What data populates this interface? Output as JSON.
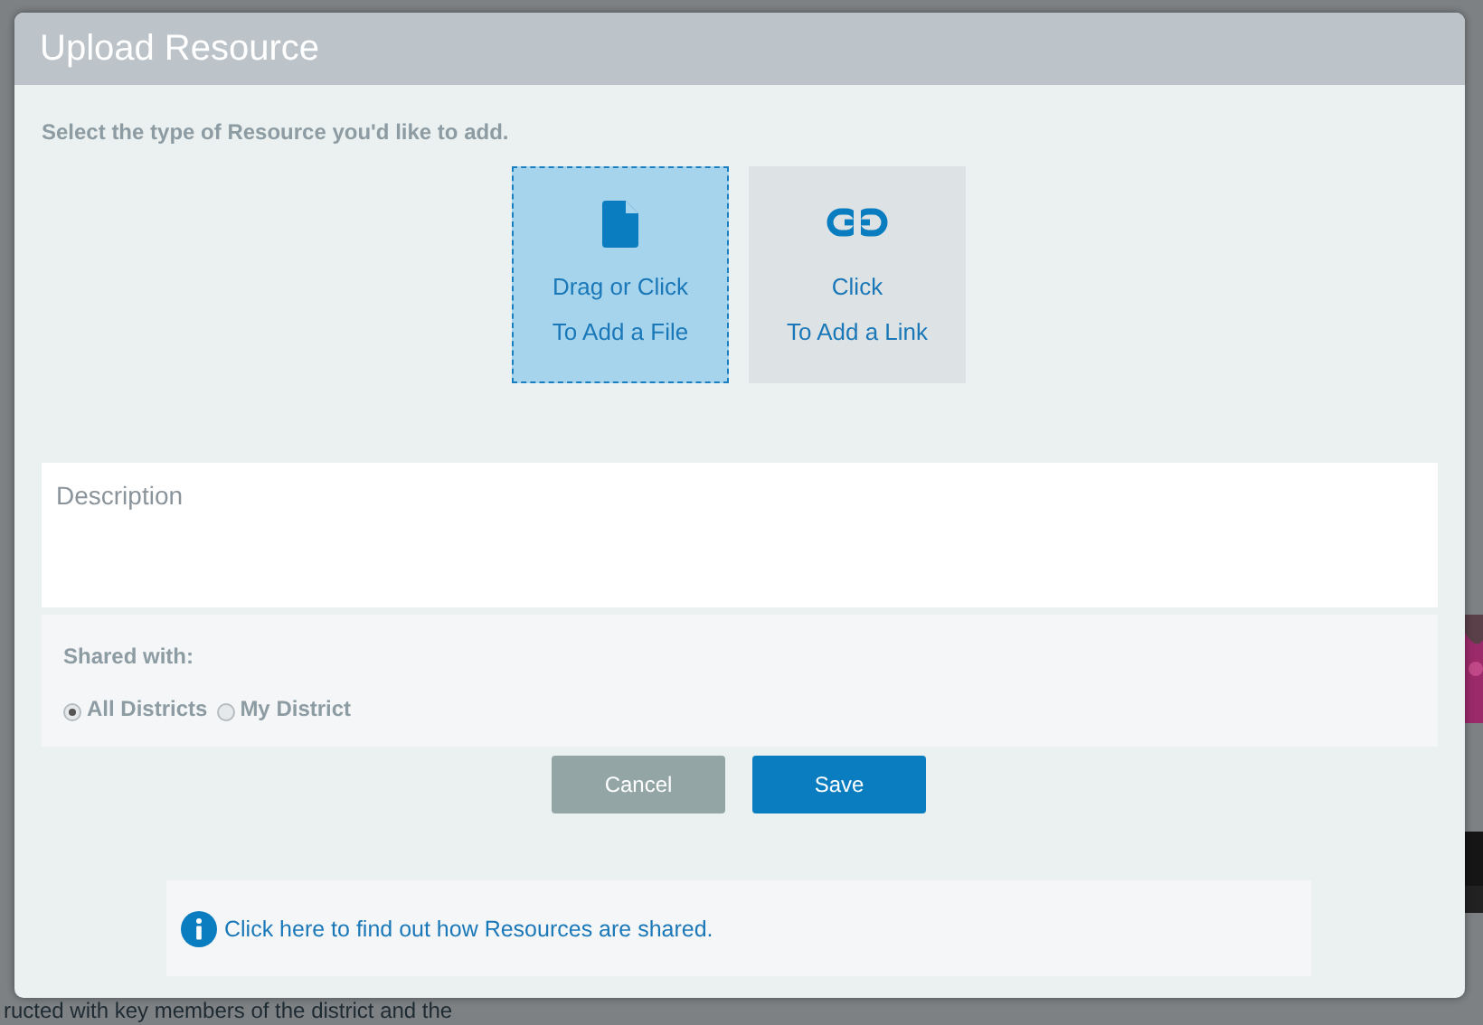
{
  "background": {
    "text": "ructed with key members of the district and the"
  },
  "dialog": {
    "title": "Upload Resource",
    "instruction": "Select the type of Resource you'd like to add.",
    "resource_types": [
      {
        "kind": "file",
        "line_1": "Drag or Click",
        "line_2": "To Add a File",
        "selected": true
      },
      {
        "kind": "link",
        "line_1": "Click",
        "line_2": "To Add a Link",
        "selected": false
      }
    ],
    "description": {
      "placeholder": "Description"
    },
    "shared_with": {
      "label": "Shared with:",
      "options": [
        {
          "label": "All Districts",
          "selected": true
        },
        {
          "label": "My District",
          "selected": false
        }
      ]
    },
    "buttons": [
      {
        "kind": "cancel",
        "label": "Cancel"
      },
      {
        "kind": "save",
        "label": "Save"
      }
    ],
    "info": {
      "link": "Click here to find out how Resources are shared."
    }
  }
}
